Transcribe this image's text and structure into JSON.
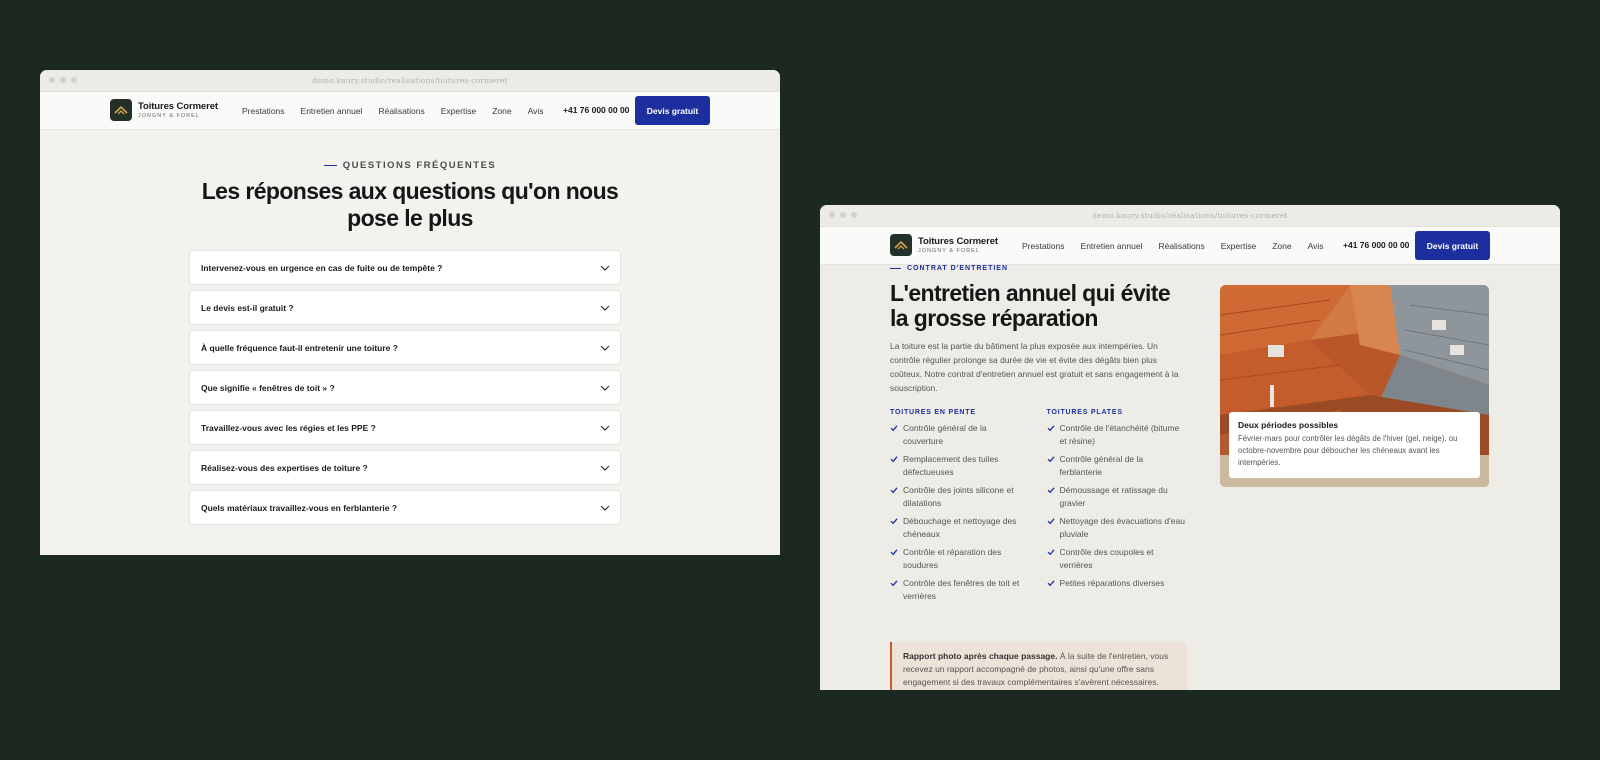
{
  "site": {
    "url": "demo.kaury.studio/realisations/toitures-cormeret",
    "brand_name": "Toitures Cormeret",
    "brand_sub": "JONGNY & FOREL",
    "menu": [
      "Prestations",
      "Entretien annuel",
      "Réalisations",
      "Expertise",
      "Zone",
      "Avis"
    ],
    "phone": "+41 76 000 00 00",
    "cta": "Devis gratuit"
  },
  "faq": {
    "eyebrow": "QUESTIONS FRÉQUENTES",
    "title": "Les réponses aux questions qu'on nous pose le plus",
    "questions": [
      "Intervenez-vous en urgence en cas de fuite ou de tempête ?",
      "Le devis est-il gratuit ?",
      "À quelle fréquence faut-il entretenir une toiture ?",
      "Que signifie « fenêtres de toit » ?",
      "Travaillez-vous avec les régies et les PPE ?",
      "Réalisez-vous des expertises de toiture ?",
      "Quels matériaux travaillez-vous en ferblanterie ?"
    ]
  },
  "entretien": {
    "url": "demo.kaury.studio/réalisations/toitures-cormeret",
    "eyebrow": "CONTRAT D'ENTRETIEN",
    "title": "L'entretien annuel qui évite la grosse réparation",
    "description": "La toiture est la partie du bâtiment la plus exposée aux intempéries. Un contrôle régulier prolonge sa durée de vie et évite des dégâts bien plus coûteux. Notre contrat d'entretien annuel est gratuit et sans engagement à la souscription.",
    "col1": {
      "heading": "TOITURES EN PENTE",
      "items": [
        "Contrôle général de la couverture",
        "Remplacement des tuiles défectueuses",
        "Contrôle des joints silicone et dilatations",
        "Débouchage et nettoyage des chéneaux",
        "Contrôle et réparation des soudures",
        "Contrôle des fenêtres de toit et verrières"
      ]
    },
    "col2": {
      "heading": "TOITURES PLATES",
      "items": [
        "Contrôle de l'étanchéité (bitume et résine)",
        "Contrôle général de la ferblanterie",
        "Démoussage et ratissage du gravier",
        "Nettoyage des évacuations d'eau pluviale",
        "Contrôle des coupoles et verrières",
        "Petites réparations diverses"
      ]
    },
    "note_bold": "Rapport photo après chaque passage.",
    "note_text": " À la suite de l'entretien, vous recevez un rapport accompagné de photos, ainsi qu'une offre sans engagement si des travaux complémentaires s'avèrent nécessaires.",
    "card_title": "Deux périodes possibles",
    "card_text": "Février-mars pour contrôler les dégâts de l'hiver (gel, neige), ou octobre-novembre pour déboucher les chéneaux avant les intempéries."
  },
  "colors": {
    "accent": "#1d2f9e",
    "background": "#1c2921",
    "note_border": "#c95a2b"
  },
  "icons": [
    "roof-logo-icon",
    "chevron-down-icon",
    "check-icon"
  ]
}
